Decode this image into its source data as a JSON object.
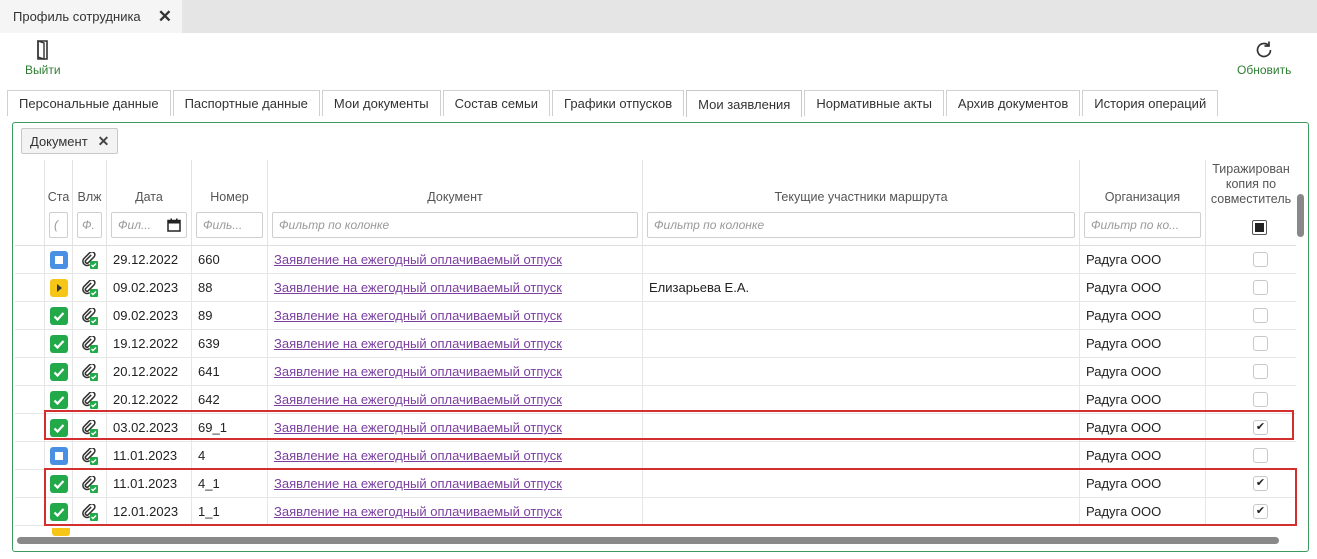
{
  "window": {
    "tab_title": "Профиль сотрудника"
  },
  "toolbar": {
    "exit_label": "Выйти",
    "refresh_label": "Обновить"
  },
  "profile_tabs": [
    "Персональные данные",
    "Паспортные данные",
    "Мои документы",
    "Состав семьи",
    "Графики отпусков",
    "Мои заявления",
    "Нормативные акты",
    "Архив документов",
    "История операций"
  ],
  "active_tab": "Мои заявления",
  "group_chip": "Документ",
  "columns": {
    "status": "Ста",
    "attach": "Влж",
    "date": "Дата",
    "number": "Номер",
    "document": "Документ",
    "participants": "Текущие участники маршрута",
    "organization": "Организация",
    "copy_line1": "Тиражирован",
    "copy_line2": "копия по",
    "copy_line3": "совместитель"
  },
  "filters": {
    "status": "(",
    "attach": "Ф.",
    "date": "Фил...",
    "number": "Филь...",
    "document": "Фильтр по колонке",
    "participants": "Фильтр по колонке",
    "organization": "Фильтр по ко..."
  },
  "rows": [
    {
      "status": "blue",
      "date": "29.12.2022",
      "number": "660",
      "document": "Заявление на ежегодный оплачиваемый отпуск",
      "participants": "",
      "organization": "Радуга ООО",
      "copy": false
    },
    {
      "status": "yellow",
      "date": "09.02.2023",
      "number": "88",
      "document": "Заявление на ежегодный оплачиваемый отпуск",
      "participants": "Елизарьева Е.А.",
      "organization": "Радуга ООО",
      "copy": false
    },
    {
      "status": "green",
      "date": "09.02.2023",
      "number": "89",
      "document": "Заявление на ежегодный оплачиваемый отпуск",
      "participants": "",
      "organization": "Радуга ООО",
      "copy": false
    },
    {
      "status": "green",
      "date": "19.12.2022",
      "number": "639",
      "document": "Заявление на ежегодный оплачиваемый отпуск",
      "participants": "",
      "organization": "Радуга ООО",
      "copy": false
    },
    {
      "status": "green",
      "date": "20.12.2022",
      "number": "641",
      "document": "Заявление на ежегодный оплачиваемый отпуск",
      "participants": "",
      "organization": "Радуга ООО",
      "copy": false
    },
    {
      "status": "green",
      "date": "20.12.2022",
      "number": "642",
      "document": "Заявление на ежегодный оплачиваемый отпуск",
      "participants": "",
      "organization": "Радуга ООО",
      "copy": false
    },
    {
      "status": "green",
      "date": "03.02.2023",
      "number": "69_1",
      "document": "Заявление на ежегодный оплачиваемый отпуск",
      "participants": "",
      "organization": "Радуга ООО",
      "copy": true
    },
    {
      "status": "blue",
      "date": "11.01.2023",
      "number": "4",
      "document": "Заявление на ежегодный оплачиваемый отпуск",
      "participants": "",
      "organization": "Радуга ООО",
      "copy": false
    },
    {
      "status": "green",
      "date": "11.01.2023",
      "number": "4_1",
      "document": "Заявление на ежегодный оплачиваемый отпуск",
      "participants": "",
      "organization": "Радуга ООО",
      "copy": true
    },
    {
      "status": "green",
      "date": "12.01.2023",
      "number": "1_1",
      "document": "Заявление на ежегодный оплачиваемый отпуск",
      "participants": "",
      "organization": "Радуга ООО",
      "copy": true
    }
  ],
  "colors": {
    "accent": "#2e7d32",
    "link": "#7b3fa0",
    "highlight": "#d32f2f",
    "status_green": "#22a94a",
    "status_blue": "#4a90e2",
    "status_yellow": "#f5c518"
  }
}
